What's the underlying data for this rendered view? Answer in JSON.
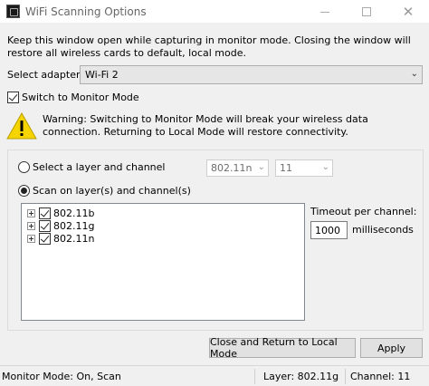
{
  "window": {
    "title": "WiFi Scanning Options"
  },
  "intro_text": "Keep this window open while capturing in monitor mode. Closing the window will restore all wireless cards to default, local mode.",
  "adapter": {
    "label": "Select adapter:",
    "selected": "Wi-Fi 2"
  },
  "monitor_mode": {
    "label": "Switch to Monitor Mode",
    "checked": true
  },
  "warning": {
    "icon": "warning-triangle-icon",
    "color": "#f5d400",
    "text": "Warning: Switching to Monitor Mode will break your wireless data connection. Returning to Local Mode will restore connectivity."
  },
  "scan": {
    "radio_layer_label": "Select a layer and channel",
    "layer_value": "802.11n",
    "channel_value": "11",
    "radio_scan_label": "Scan on layer(s) and channel(s)",
    "selected_radio": "scan",
    "layers": [
      {
        "label": "802.11b",
        "checked": true
      },
      {
        "label": "802.11g",
        "checked": true
      },
      {
        "label": "802.11n",
        "checked": true
      }
    ],
    "timeout_label": "Timeout per channel:",
    "timeout_value": "1000",
    "timeout_unit": "milliseconds"
  },
  "buttons": {
    "return_label": "Close and Return to Local Mode",
    "apply_label": "Apply"
  },
  "status": {
    "mode": "Monitor Mode: On, Scan",
    "layer": "Layer: 802.11g",
    "channel": "Channel: 11"
  }
}
